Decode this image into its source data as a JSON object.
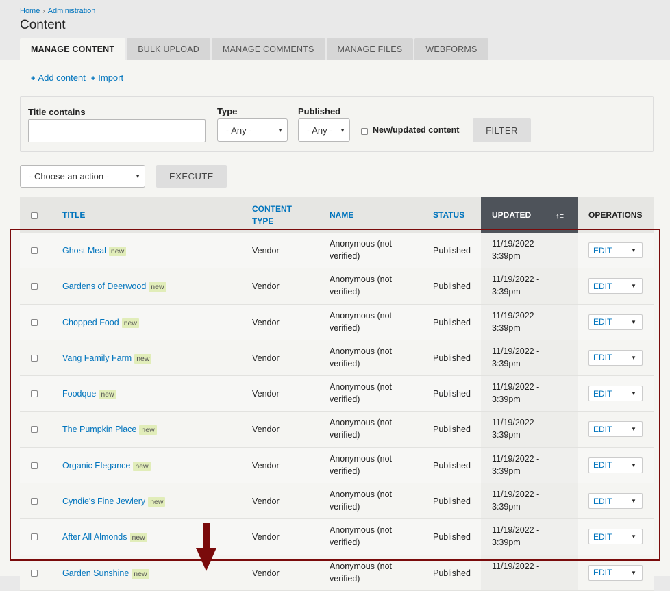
{
  "breadcrumb": [
    "Home",
    "Administration"
  ],
  "page_title": "Content",
  "tabs": [
    "MANAGE CONTENT",
    "BULK UPLOAD",
    "MANAGE COMMENTS",
    "MANAGE FILES",
    "WEBFORMS"
  ],
  "action_links": {
    "add": "Add content",
    "import": "Import"
  },
  "filter": {
    "title_label": "Title contains",
    "type_label": "Type",
    "type_value": "- Any -",
    "published_label": "Published",
    "published_value": "- Any -",
    "new_updated_label": "New/updated content",
    "filter_button": "FILTER"
  },
  "bulk": {
    "action_value": "- Choose an action -",
    "execute_button": "EXECUTE"
  },
  "table": {
    "headers": {
      "title": "TITLE",
      "content_type_1": "CONTENT",
      "content_type_2": "TYPE",
      "name": "NAME",
      "status": "STATUS",
      "updated": "UPDATED",
      "operations": "OPERATIONS"
    },
    "badge": "new",
    "edit_label": "EDIT",
    "rows": [
      {
        "title": "Ghost Meal",
        "type": "Vendor",
        "name1": "Anonymous (not",
        "name2": "verified)",
        "status": "Published",
        "date1": "11/19/2022 -",
        "date2": "3:39pm"
      },
      {
        "title": "Gardens of Deerwood",
        "type": "Vendor",
        "name1": "Anonymous (not",
        "name2": "verified)",
        "status": "Published",
        "date1": "11/19/2022 -",
        "date2": "3:39pm"
      },
      {
        "title": "Chopped Food",
        "type": "Vendor",
        "name1": "Anonymous (not",
        "name2": "verified)",
        "status": "Published",
        "date1": "11/19/2022 -",
        "date2": "3:39pm"
      },
      {
        "title": "Vang Family Farm",
        "type": "Vendor",
        "name1": "Anonymous (not",
        "name2": "verified)",
        "status": "Published",
        "date1": "11/19/2022 -",
        "date2": "3:39pm"
      },
      {
        "title": "Foodque",
        "type": "Vendor",
        "name1": "Anonymous (not",
        "name2": "verified)",
        "status": "Published",
        "date1": "11/19/2022 -",
        "date2": "3:39pm"
      },
      {
        "title": "The Pumpkin Place",
        "type": "Vendor",
        "name1": "Anonymous (not",
        "name2": "verified)",
        "status": "Published",
        "date1": "11/19/2022 -",
        "date2": "3:39pm"
      },
      {
        "title": "Organic Elegance",
        "type": "Vendor",
        "name1": "Anonymous (not",
        "name2": "verified)",
        "status": "Published",
        "date1": "11/19/2022 -",
        "date2": "3:39pm"
      },
      {
        "title": "Cyndie's Fine Jewlery",
        "type": "Vendor",
        "name1": "Anonymous (not",
        "name2": "verified)",
        "status": "Published",
        "date1": "11/19/2022 -",
        "date2": "3:39pm"
      },
      {
        "title": "After All Almonds",
        "type": "Vendor",
        "name1": "Anonymous (not",
        "name2": "verified)",
        "status": "Published",
        "date1": "11/19/2022 -",
        "date2": "3:39pm"
      },
      {
        "title": "Garden Sunshine",
        "type": "Vendor",
        "name1": "Anonymous (not",
        "name2": "verified)",
        "status": "Published",
        "date1": "11/19/2022 -",
        "date2": ""
      }
    ]
  },
  "colors": {
    "link": "#0074bd",
    "sorted_header": "#4e535a",
    "annotation": "#7a0b0b",
    "badge": "#e1edb9"
  }
}
